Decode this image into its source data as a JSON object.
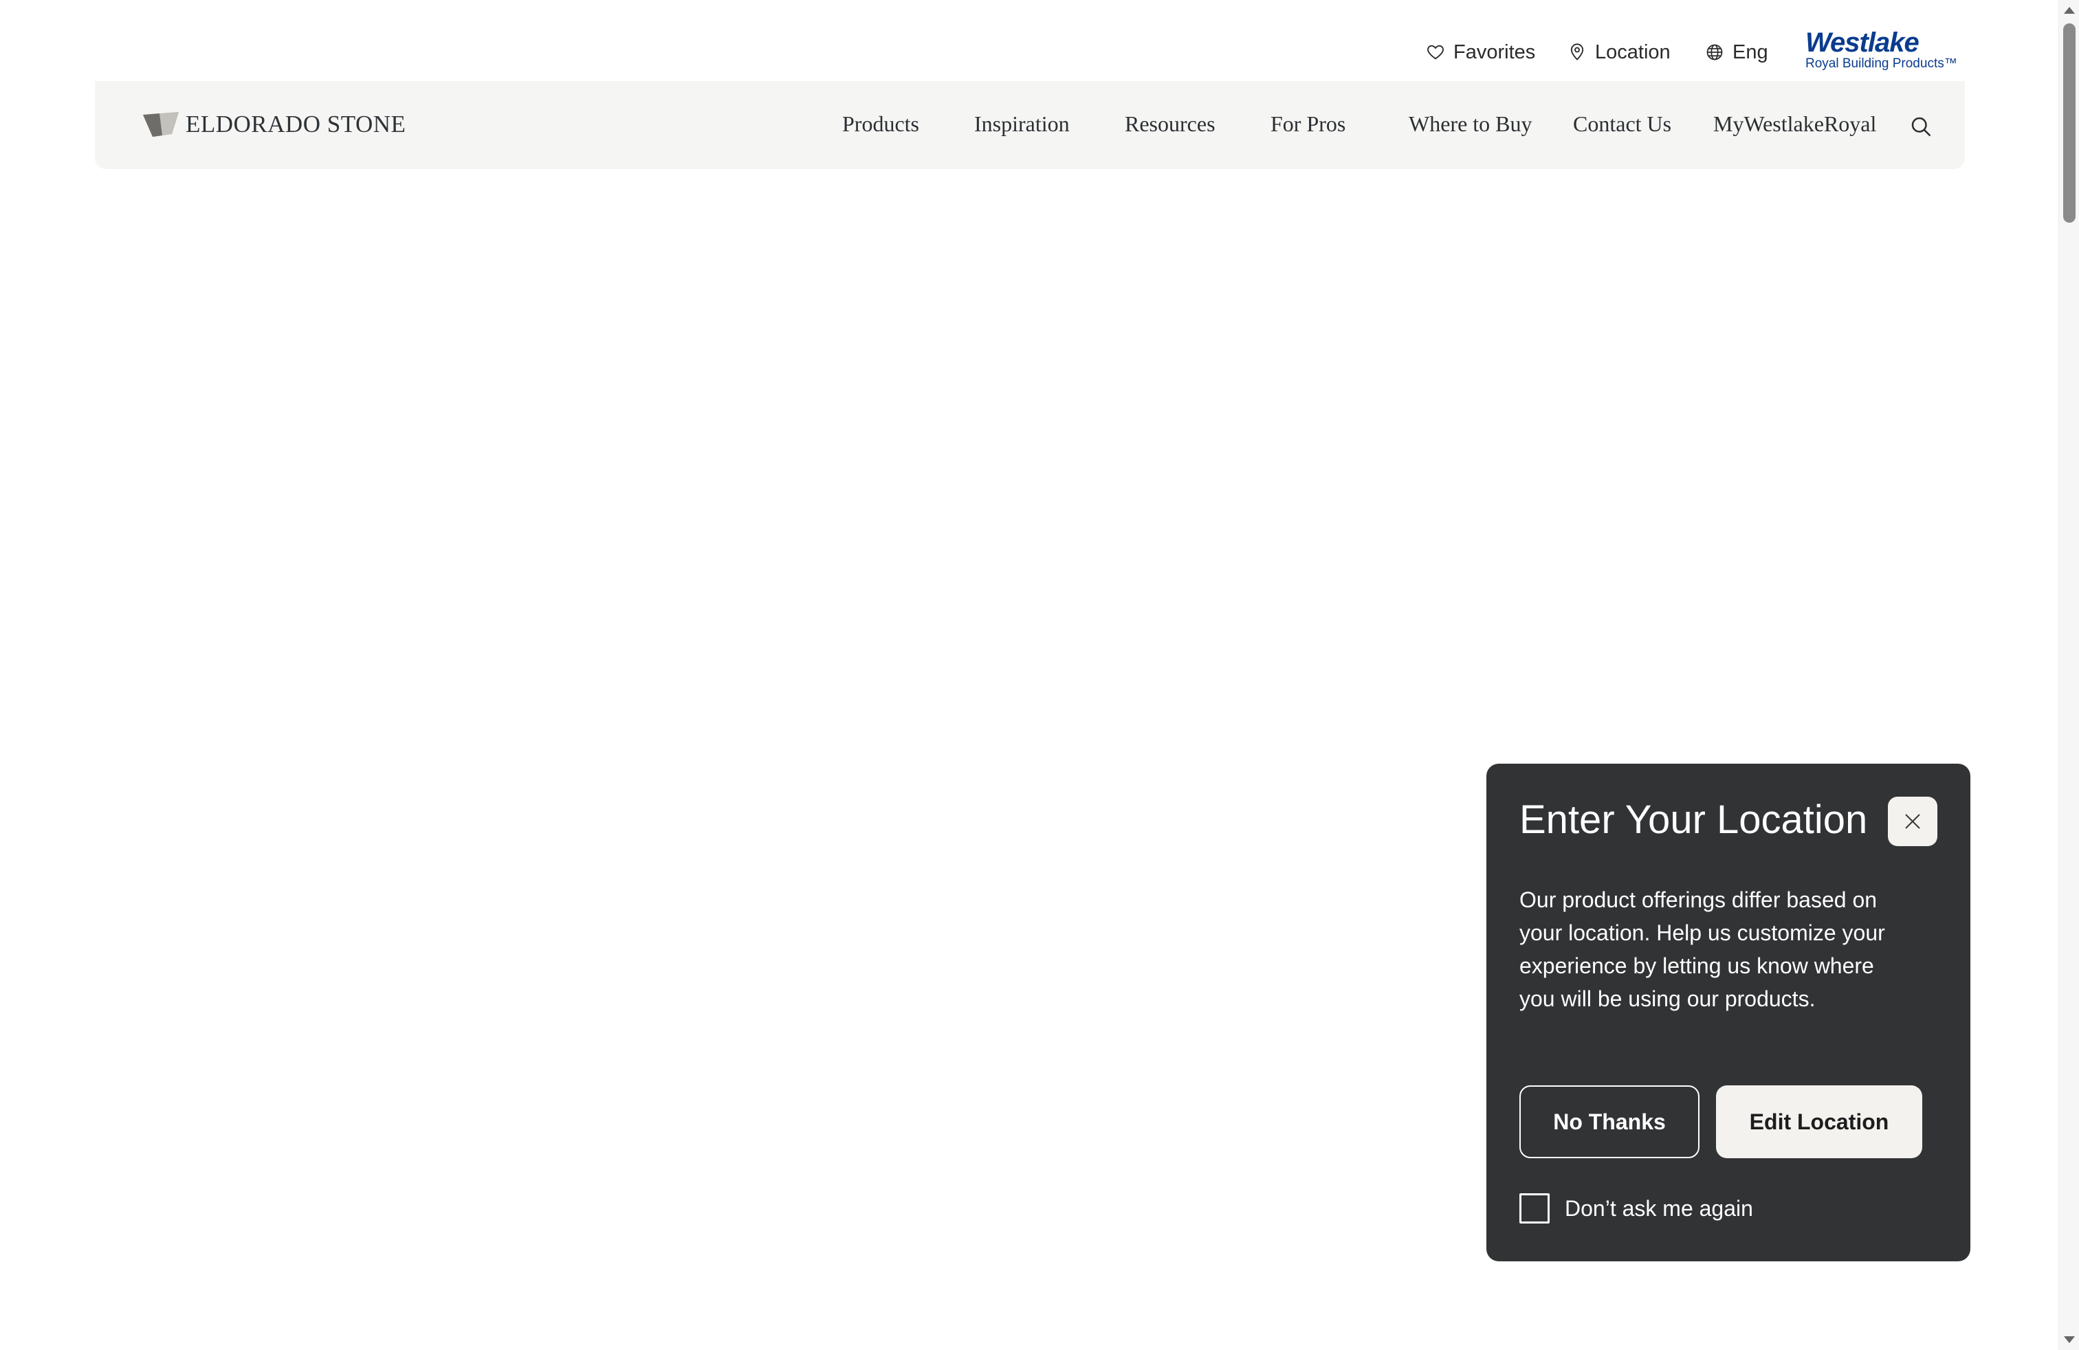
{
  "utility": {
    "favorites": "Favorites",
    "location": "Location",
    "language": "Eng",
    "partner_logo": {
      "main": "Westlake",
      "sub": "Royal Building Products™"
    }
  },
  "brand": {
    "name": "ELDORADO STONE"
  },
  "nav": {
    "items": [
      {
        "label": "Products"
      },
      {
        "label": "Inspiration"
      },
      {
        "label": "Resources"
      },
      {
        "label": "For Pros"
      },
      {
        "label": "Where to Buy"
      },
      {
        "label": "Contact Us"
      },
      {
        "label": "MyWestlakeRoyal"
      }
    ],
    "search_icon": "search-icon"
  },
  "location_popup": {
    "title": "Enter Your Location",
    "body": "Our product offerings differ based on your location. Help us customize your experience by letting us know where you will be using our products.",
    "no_thanks_label": "No Thanks",
    "edit_location_label": "Edit Location",
    "dont_ask_label": "Don’t ask me again",
    "dont_ask_checked": false
  },
  "colors": {
    "popup_bg": "#323335",
    "nav_bg": "#f5f5f4",
    "button_light": "#f4f2ef",
    "westlake_blue": "#0a3c8f",
    "westlake_light_blue": "#1c8ed6"
  }
}
